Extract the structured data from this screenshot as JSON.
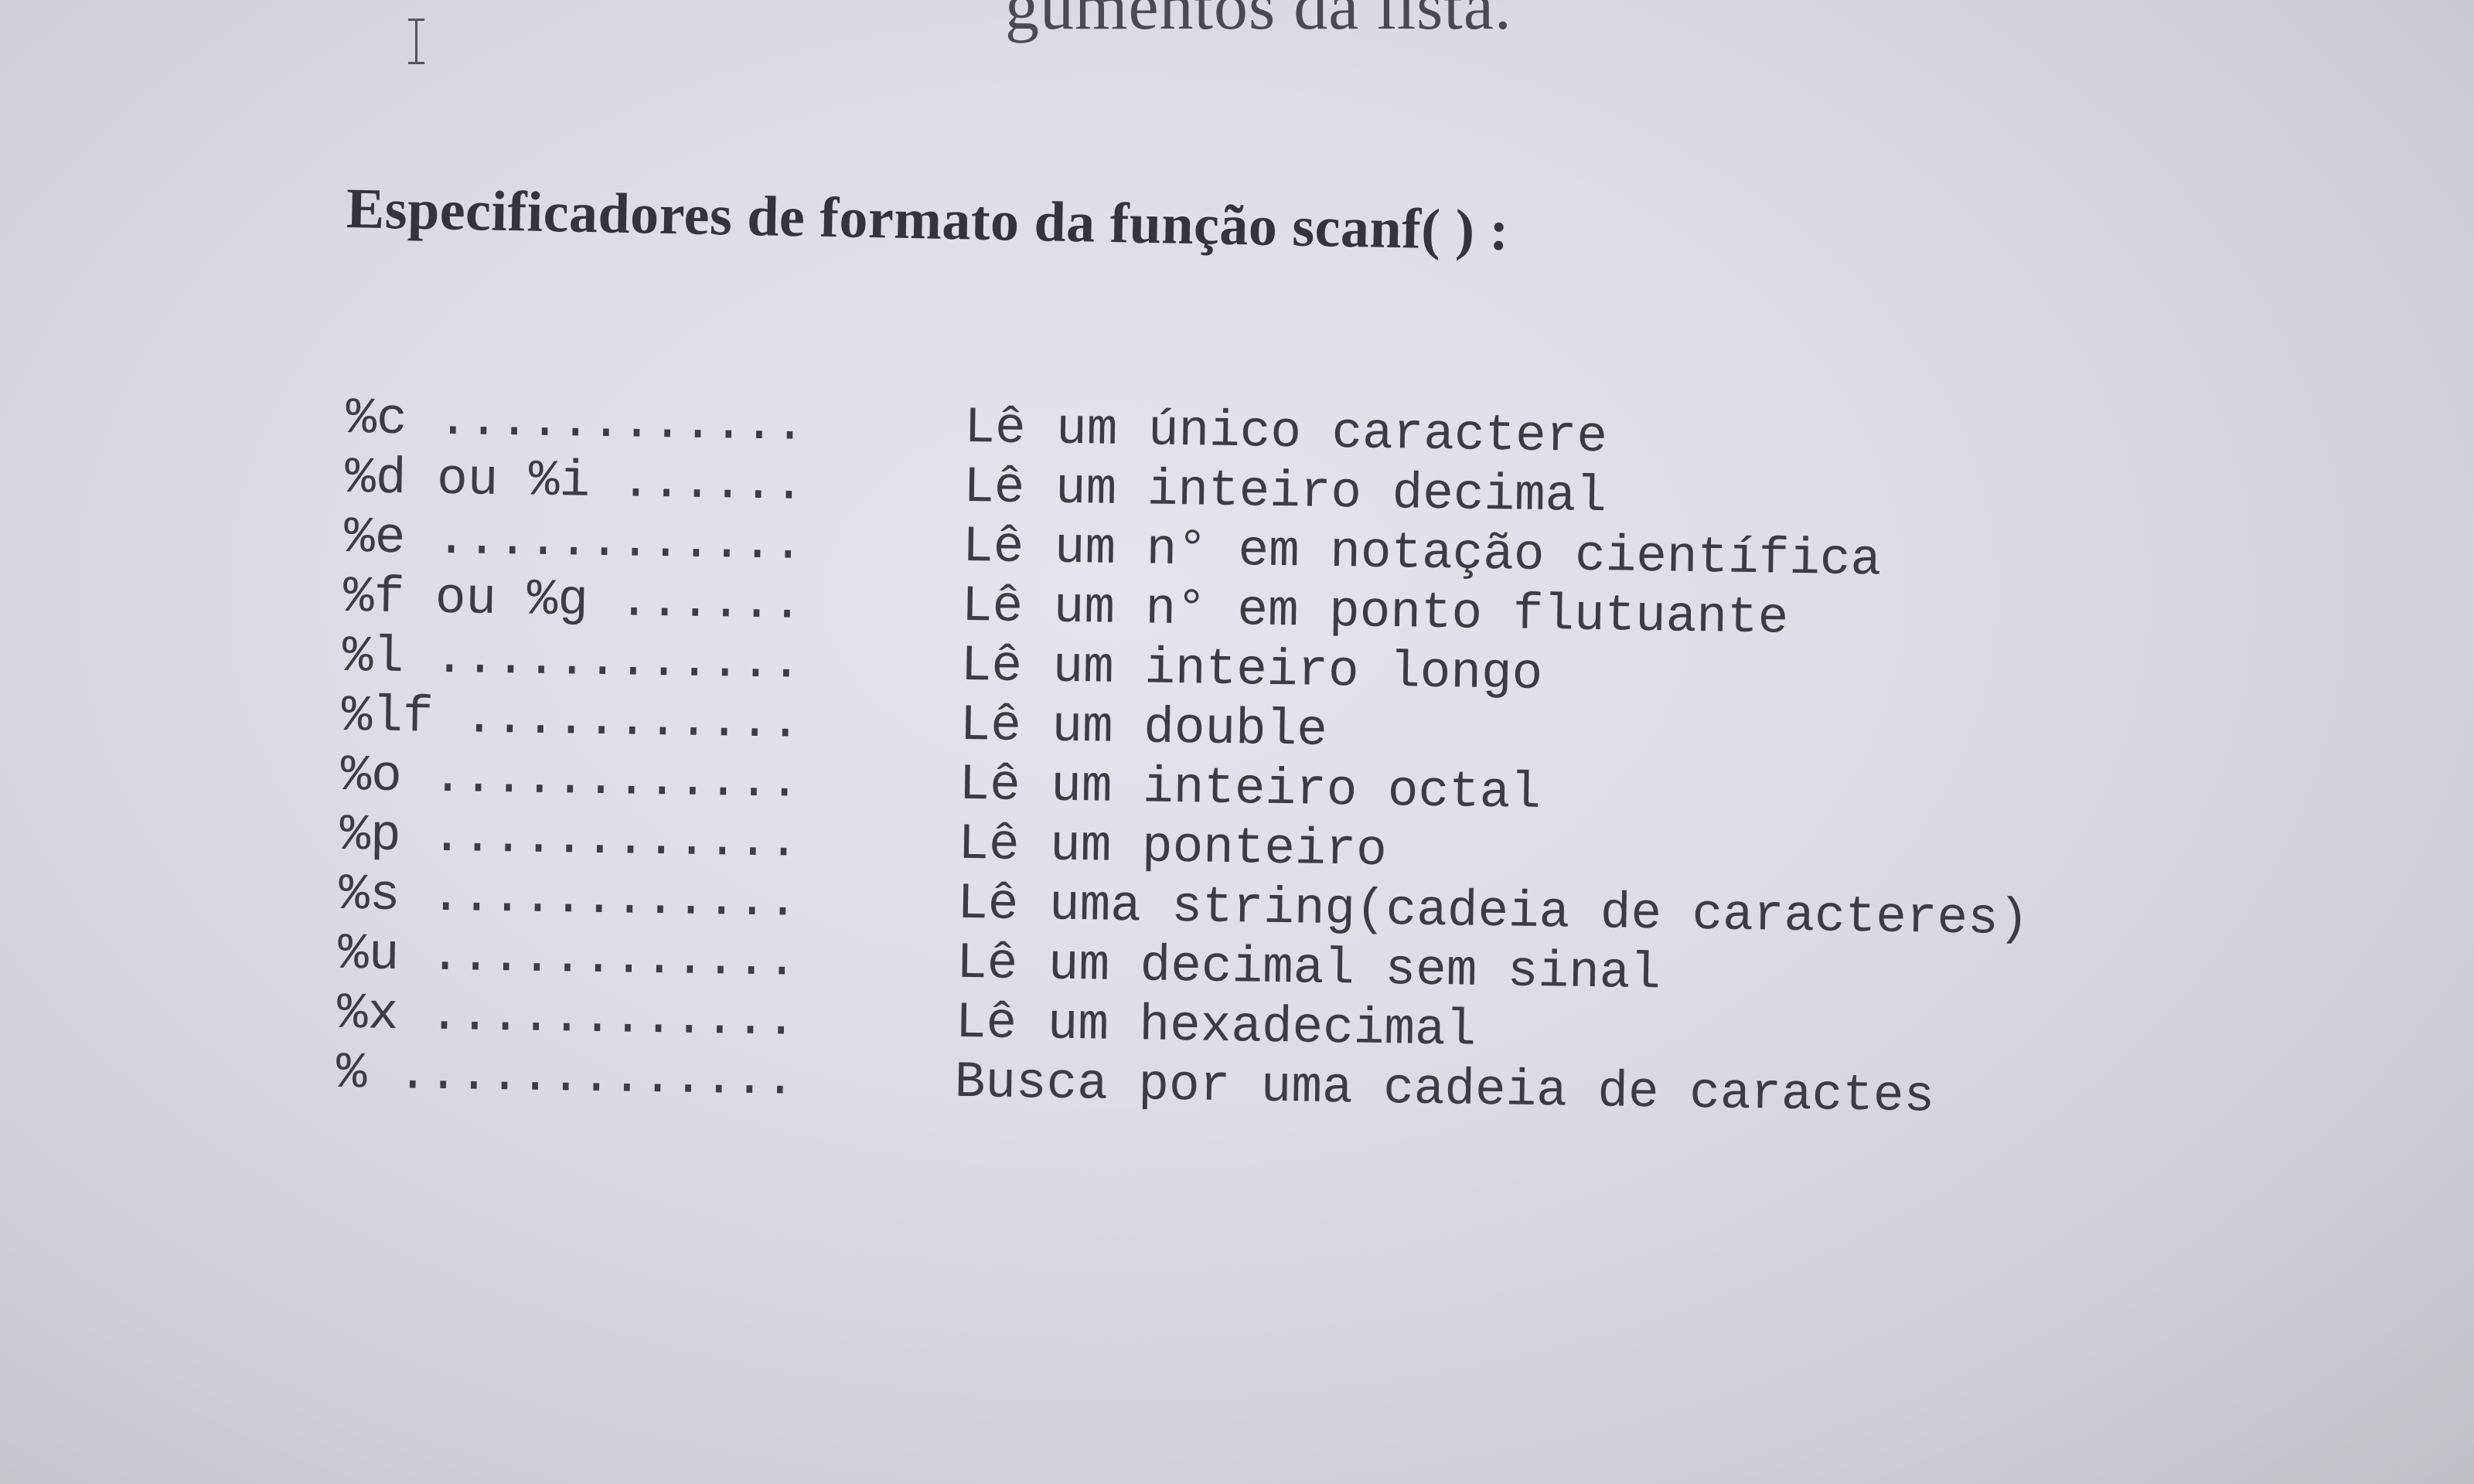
{
  "top_fragment": {
    "text": "gumentos da lista."
  },
  "heading": "Especificadores de formato da função scanf( ) :",
  "specifiers": [
    {
      "lead": "%c ............",
      "description": "Lê um único caractere"
    },
    {
      "lead": "%d ou %i ......",
      "description": "Lê um inteiro decimal"
    },
    {
      "lead": "%e ............",
      "description": "Lê um n° em notação científica"
    },
    {
      "lead": "%f ou %g ......",
      "description": "Lê um n° em ponto flutuante"
    },
    {
      "lead": "%l ............",
      "description": "Lê um inteiro longo"
    },
    {
      "lead": "%lf ...........",
      "description": "Lê um double"
    },
    {
      "lead": "%o ............",
      "description": "Lê um inteiro octal"
    },
    {
      "lead": "%p ............",
      "description": "Lê um ponteiro"
    },
    {
      "lead": "%s ............",
      "description": "Lê uma string(cadeia de caracteres)"
    },
    {
      "lead": "%u ............",
      "description": "Lê um decimal sem sinal"
    },
    {
      "lead": "%x ............",
      "description": "Lê um hexadecimal"
    },
    {
      "lead": "% .............",
      "description": "Busca por uma cadeia de caractes"
    }
  ]
}
